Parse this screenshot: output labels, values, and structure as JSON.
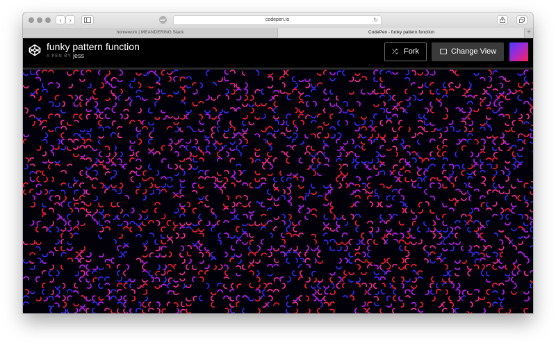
{
  "browser": {
    "address": "codepen.io",
    "tabs": [
      {
        "label": "homework | MEANDERING Slack",
        "active": false
      },
      {
        "label": "CodePen - funky pattern function",
        "active": true
      }
    ],
    "new_tab_label": "+"
  },
  "header": {
    "title": "funky pattern function",
    "by_label": "A PEN BY",
    "author": "jess",
    "fork_label": "Fork",
    "change_view_label": "Change View"
  },
  "icons": {
    "back": "chevron-left-icon",
    "forward": "chevron-right-icon",
    "sidebar": "sidebar-icon",
    "reload": "reload-icon",
    "share": "share-icon",
    "tabs": "tabs-overview-icon",
    "logo": "codepen-logo-icon",
    "fork": "fork-icon",
    "change_view": "change-view-icon"
  },
  "colors": {
    "background": "#000000",
    "pattern": [
      "#ff1e3c",
      "#c21fff",
      "#3a2bff",
      "#ff2f9a"
    ]
  }
}
